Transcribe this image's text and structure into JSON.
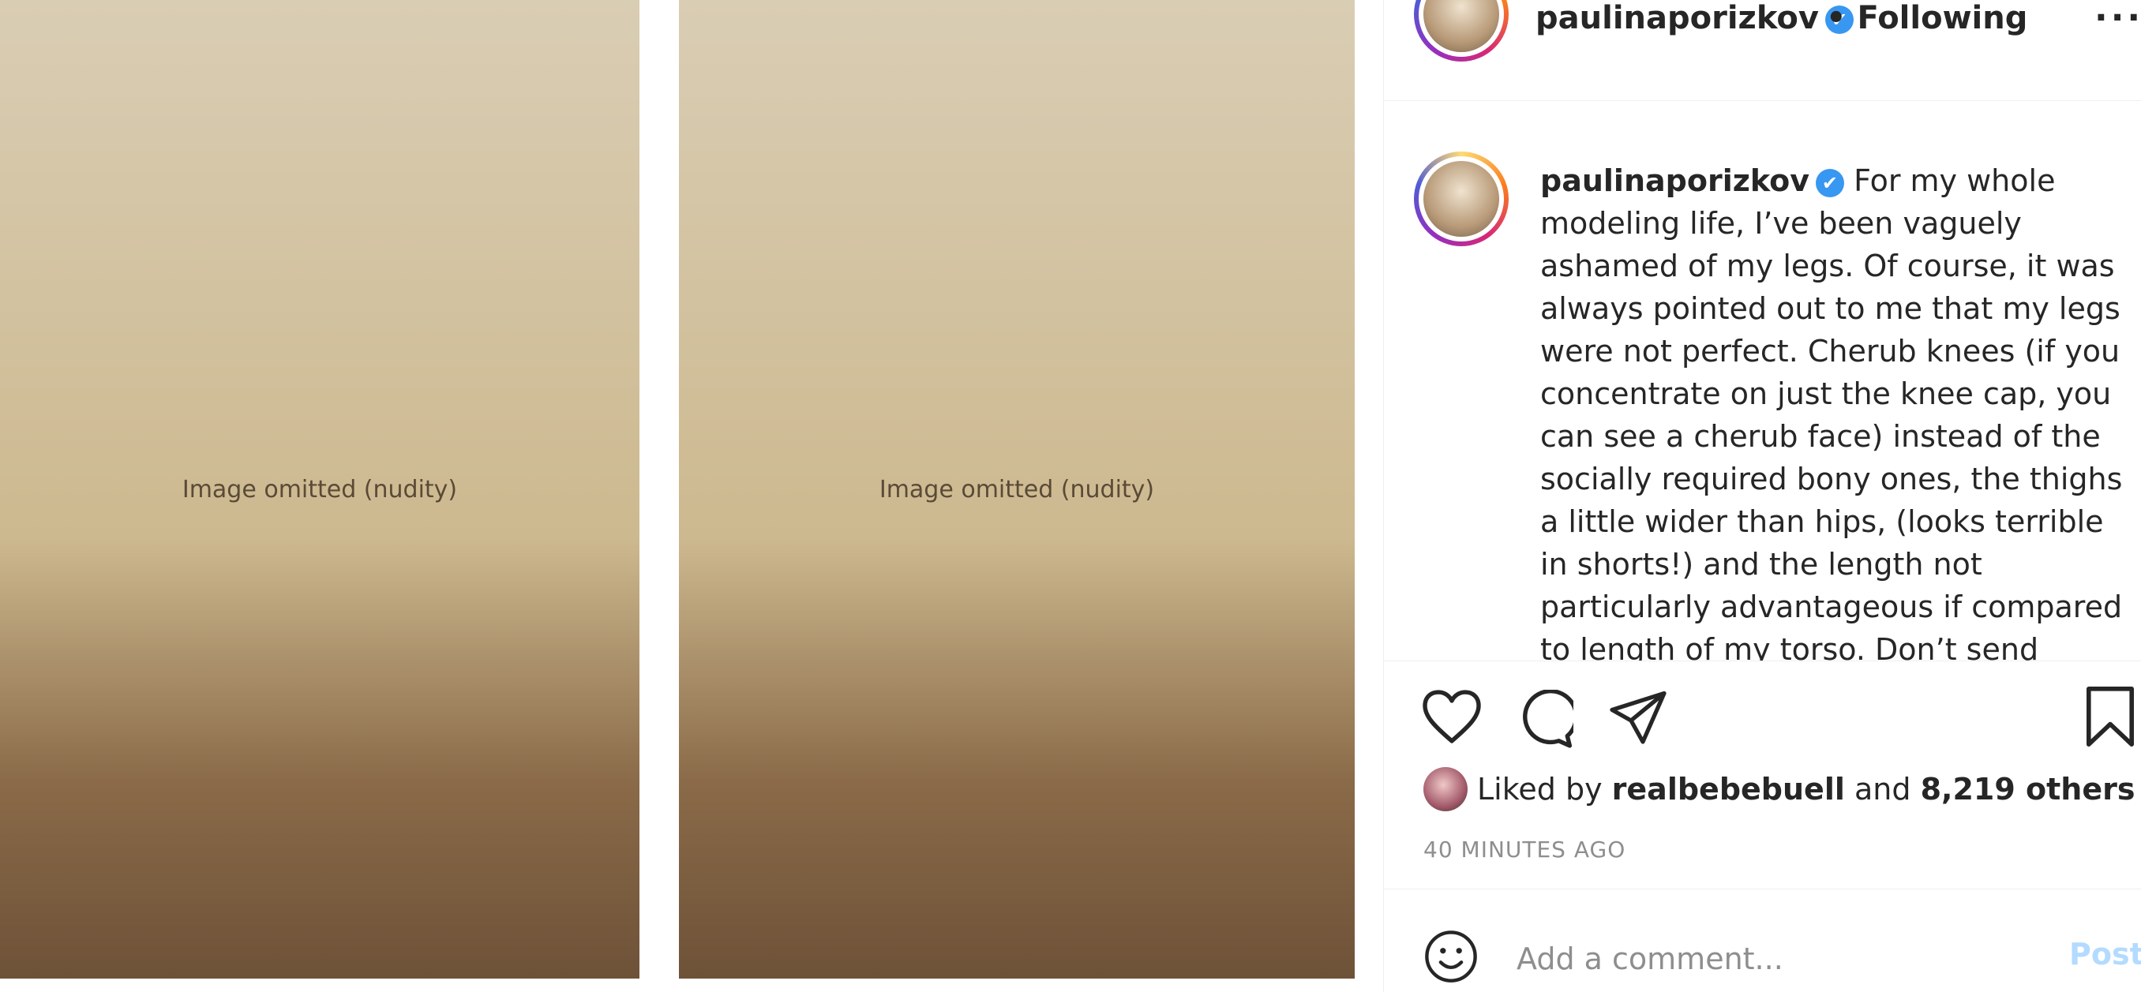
{
  "media": {
    "left_photo_note": "Image omitted (nudity)",
    "right_photo_note": "Image omitted (nudity)"
  },
  "header": {
    "username": "paulinaporizkov",
    "verified_icon": "✔",
    "follow_status": "• Following",
    "more": "..."
  },
  "caption": {
    "username": "paulinaporizkov",
    "verified_icon": "✔",
    "text": "For my whole modeling life, I’ve been vaguely ashamed of my legs. Of course, it was always pointed out to me that my legs were not perfect. Cherub knees (if you concentrate on just the knee cap, you can see a cherub face) instead of the socially required bony ones, the thighs a little wider than hips, (looks terrible in shorts!) and the length not particularly advantageous if compared to length of my torso. Don’t send"
  },
  "actions": {
    "icons": [
      "heart-icon",
      "comment-icon",
      "share-icon",
      "bookmark-icon"
    ]
  },
  "likes": {
    "prefix": "Liked by",
    "liker": "realbebebuell",
    "and": "and",
    "others": "8,219 others"
  },
  "timestamp": "40 MINUTES AGO",
  "comment": {
    "placeholder": "Add a comment...",
    "post_label": "Post"
  },
  "colors": {
    "verified": "#3897f0",
    "post_disabled": "#b3dbff",
    "muted": "#8e8e8e"
  }
}
